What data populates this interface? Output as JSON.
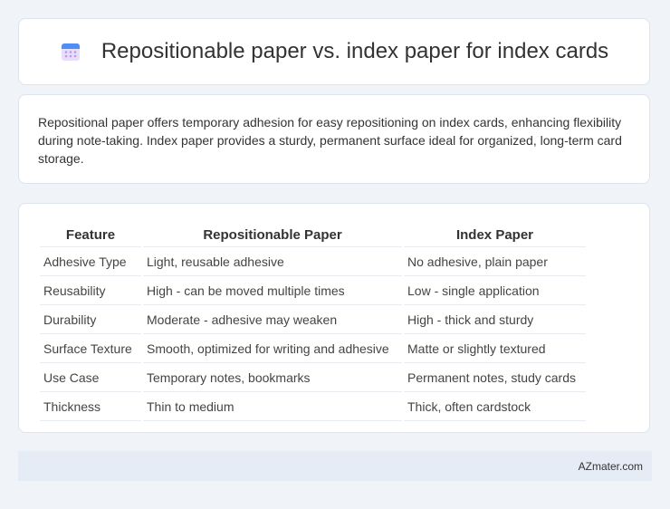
{
  "header": {
    "title": "Repositionable paper vs. index paper for index cards",
    "icon": "calendar-icon"
  },
  "description": "Repositional paper offers temporary adhesion for easy repositioning on index cards, enhancing flexibility during note-taking. Index paper provides a sturdy, permanent surface ideal for organized, long-term card storage.",
  "table": {
    "headers": [
      "Feature",
      "Repositionable Paper",
      "Index Paper"
    ],
    "rows": [
      [
        "Adhesive Type",
        "Light, reusable adhesive",
        "No adhesive, plain paper"
      ],
      [
        "Reusability",
        "High - can be moved multiple times",
        "Low - single application"
      ],
      [
        "Durability",
        "Moderate - adhesive may weaken",
        "High - thick and sturdy"
      ],
      [
        "Surface Texture",
        "Smooth, optimized for writing and adhesive",
        "Matte or slightly textured"
      ],
      [
        "Use Case",
        "Temporary notes, bookmarks",
        "Permanent notes, study cards"
      ],
      [
        "Thickness",
        "Thin to medium",
        "Thick, often cardstock"
      ]
    ]
  },
  "footer": {
    "site": "AZmater.com"
  }
}
